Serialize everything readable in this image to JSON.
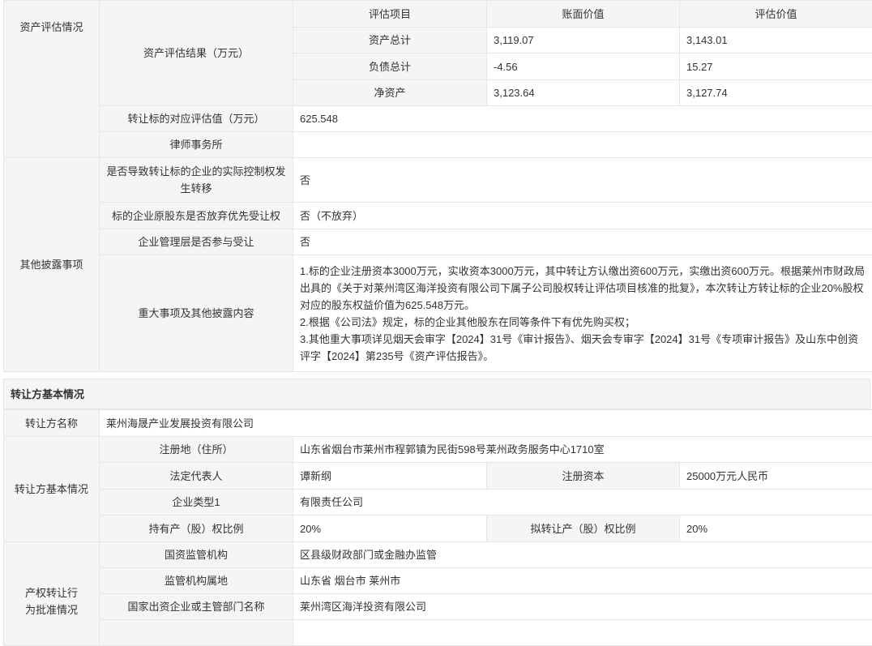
{
  "assess": {
    "section_label": "资产评估情况",
    "result_label": "资产评估结果（万元）",
    "headers": [
      "评估项目",
      "账面价值",
      "评估价值"
    ],
    "rows": [
      {
        "item": "资产总计",
        "book": "3,119.07",
        "eval": "3,143.01"
      },
      {
        "item": "负债总计",
        "book": "-4.56",
        "eval": "15.27"
      },
      {
        "item": "净资产",
        "book": "3,123.64",
        "eval": "3,127.74"
      }
    ],
    "target_value_label": "转让标的对应评估值（万元）",
    "target_value": "625.548",
    "law_firm_label": "律师事务所",
    "law_firm": ""
  },
  "disclosure": {
    "section_label": "其他披露事项",
    "control_change_label": "是否导致转让标的企业的实际控制权发生转移",
    "control_change": "否",
    "waive_label": "标的企业原股东是否放弃优先受让权",
    "waive": "否（不放弃）",
    "mgmt_label": "企业管理层是否参与受让",
    "mgmt": "否",
    "major_label": "重大事项及其他披露内容",
    "major_lines": [
      "1.标的企业注册资本3000万元，实收资本3000万元，其中转让方认缴出资600万元，实缴出资600万元。根据莱州市财政局出具的《关于对莱州湾区海洋投资有限公司下属子公司股权转让评估项目核准的批复》，本次转让方转让标的企业20%股权对应的股东权益价值为625.548万元。",
      "2.根据《公司法》规定，标的企业其他股东在同等条件下有优先购买权；",
      "3.其他重大事项详见烟天会审字【2024】31号《审计报告》、烟天会专审字【2024】31号《专项审计报告》及山东中创资评字【2024】第235号《资产评估报告》。"
    ]
  },
  "transferor": {
    "title": "转让方基本情况",
    "name_label": "转让方名称",
    "name": "莱州海晟产业发展投资有限公司",
    "basic_label": "转让方基本情况",
    "address_label": "注册地（住所）",
    "address": "山东省烟台市莱州市程郭镇为民街598号莱州政务服务中心1710室",
    "legal_rep_label": "法定代表人",
    "legal_rep": "谭新纲",
    "capital_label": "注册资本",
    "capital": "25000万元人民币",
    "type_label": "企业类型1",
    "type": "有限责任公司",
    "hold_label": "持有产（股）权比例",
    "hold": "20%",
    "plan_label": "拟转让产（股）权比例",
    "plan": "20%"
  },
  "approval": {
    "section_label": "产权转让行为批准情况",
    "regulator_label": "国资监管机构",
    "regulator": "区县级财政部门或金融办监管",
    "location_label": "监管机构属地",
    "location": "山东省 烟台市 莱州市",
    "dept_label": "国家出资企业或主管部门名称",
    "dept": "莱州湾区海洋投资有限公司"
  }
}
